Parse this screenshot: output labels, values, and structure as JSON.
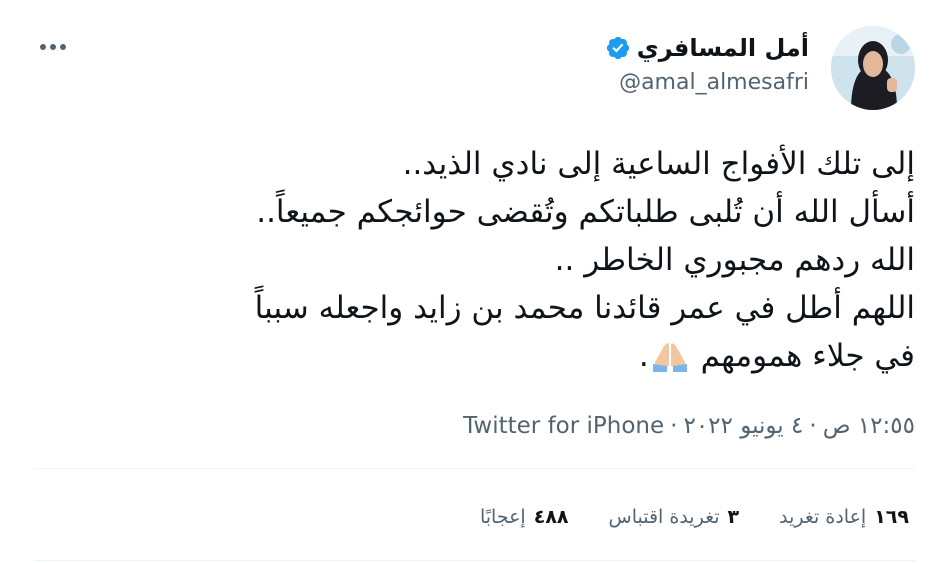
{
  "author": {
    "display_name": "أمل المسافري",
    "handle": "@amal_almesafri",
    "verified": true
  },
  "tweet": {
    "lines": [
      "إلى تلك الأفواج الساعية إلى نادي الذيد..",
      "أسأل الله أن تُلبى طلباتكم وتُقضى حوائجكم جميعاً..",
      "الله ردهم مجبوري الخاطر ..",
      "اللهم أطل في عمر قائدنا محمد بن زايد واجعله سبباً",
      "في جلاء همومهم",
      "."
    ],
    "emoji": "folded-hands"
  },
  "meta": {
    "time": "١٢:٥٥ ص",
    "date": "٤ يونيو ٢٠٢٢",
    "separator": "·",
    "client": "Twitter for iPhone"
  },
  "stats": {
    "retweets_count": "١٦٩",
    "retweets_label": "إعادة تغريد",
    "quotes_count": "٣",
    "quotes_label": "تغريدة اقتباس",
    "likes_count": "٤٨٨",
    "likes_label": "إعجابًا"
  },
  "icons": {
    "verified": "verified-badge-icon",
    "more": "more-options-icon"
  },
  "colors": {
    "verified_blue": "#1d9bf0",
    "secondary_text": "#536471",
    "primary_text": "#0f1419",
    "divider": "#eff3f4"
  }
}
